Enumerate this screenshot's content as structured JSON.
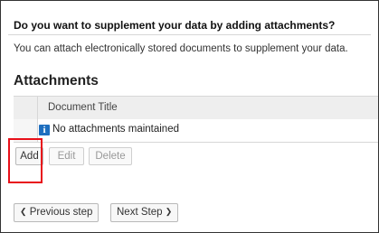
{
  "question": "Do you want to supplement your data by adding attachments?",
  "hint": "You can attach electronically stored documents to supplement your data.",
  "section_title": "Attachments",
  "table": {
    "columns": [
      "Document Title"
    ],
    "empty_message": "No attachments maintained"
  },
  "actions": {
    "add_label": "Add",
    "edit_label": "Edit",
    "delete_label": "Delete"
  },
  "navigation": {
    "previous_label": "Previous step",
    "next_label": "Next Step"
  },
  "icons": {
    "info": "info-icon",
    "prev": "chevron-left-icon",
    "next": "chevron-right-icon"
  },
  "colors": {
    "highlight": "#e8101a",
    "info_icon": "#1f6fbf"
  }
}
